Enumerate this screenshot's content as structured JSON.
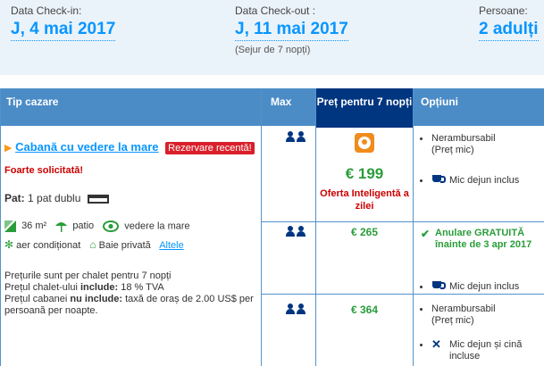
{
  "dates": {
    "checkin_label": "Data Check-in:",
    "checkin_value": "J, 4 mai 2017",
    "checkout_label": "Data Check-out :",
    "checkout_value": "J, 11 mai 2017",
    "stay_length": "(Sejur de 7 nopți)",
    "persons_label": "Persoane:",
    "persons_value": "2 adulți"
  },
  "table": {
    "headers": {
      "type": "Tip cazare",
      "max": "Max",
      "price": "Preț pentru 7 nopți",
      "options": "Opțiuni"
    },
    "room": {
      "name": "Cabană cu vedere la mare",
      "recent_badge": "Rezervare recentă!",
      "demand": "Foarte solicitată!",
      "bed_label": "Pat:",
      "bed_value": "1 pat dublu",
      "facilities": {
        "area": "36 m²",
        "patio": "patio",
        "sea_view": "vedere la mare",
        "ac": "aer condiționat",
        "bathroom": "Baie privată",
        "others_link": "Altele"
      },
      "notes": {
        "line1": "Prețurile sunt per chalet pentru 7 nopți",
        "line2_prefix": "Prețul chalet-ului ",
        "line2_bold": "include:",
        "line2_rest": " 18 % TVA",
        "line3_prefix": "Prețul cabanei ",
        "line3_bold": "nu include:",
        "line3_rest": " taxă de oraș de 2.00 US$ per persoană per noapte."
      }
    },
    "rows": [
      {
        "price": "€ 199",
        "smart_deal": "Oferta Inteligentă a zilei",
        "option1_line1": "Nerambursabil",
        "option1_line2": "(Preț mic)",
        "meal": "Mic dejun inclus"
      },
      {
        "price": "€ 265",
        "cancel": "Anulare GRATUITĂ înainte de 3 apr 2017",
        "meal": "Mic dejun inclus"
      },
      {
        "price": "€ 364",
        "option1_line1": "Nerambursabil",
        "option1_line2": "(Preț mic)",
        "meal_line1": "Mic dejun și cină",
        "meal_line2": "incluse"
      }
    ]
  },
  "colors": {
    "accent": "#0896ff",
    "header_blue": "#4b8cc7",
    "header_dark": "#003580",
    "price_green": "#2a9d3a",
    "alert_red": "#cc0000",
    "badge_red": "#d91f2a",
    "datebar_bg": "#ebf3fa"
  }
}
